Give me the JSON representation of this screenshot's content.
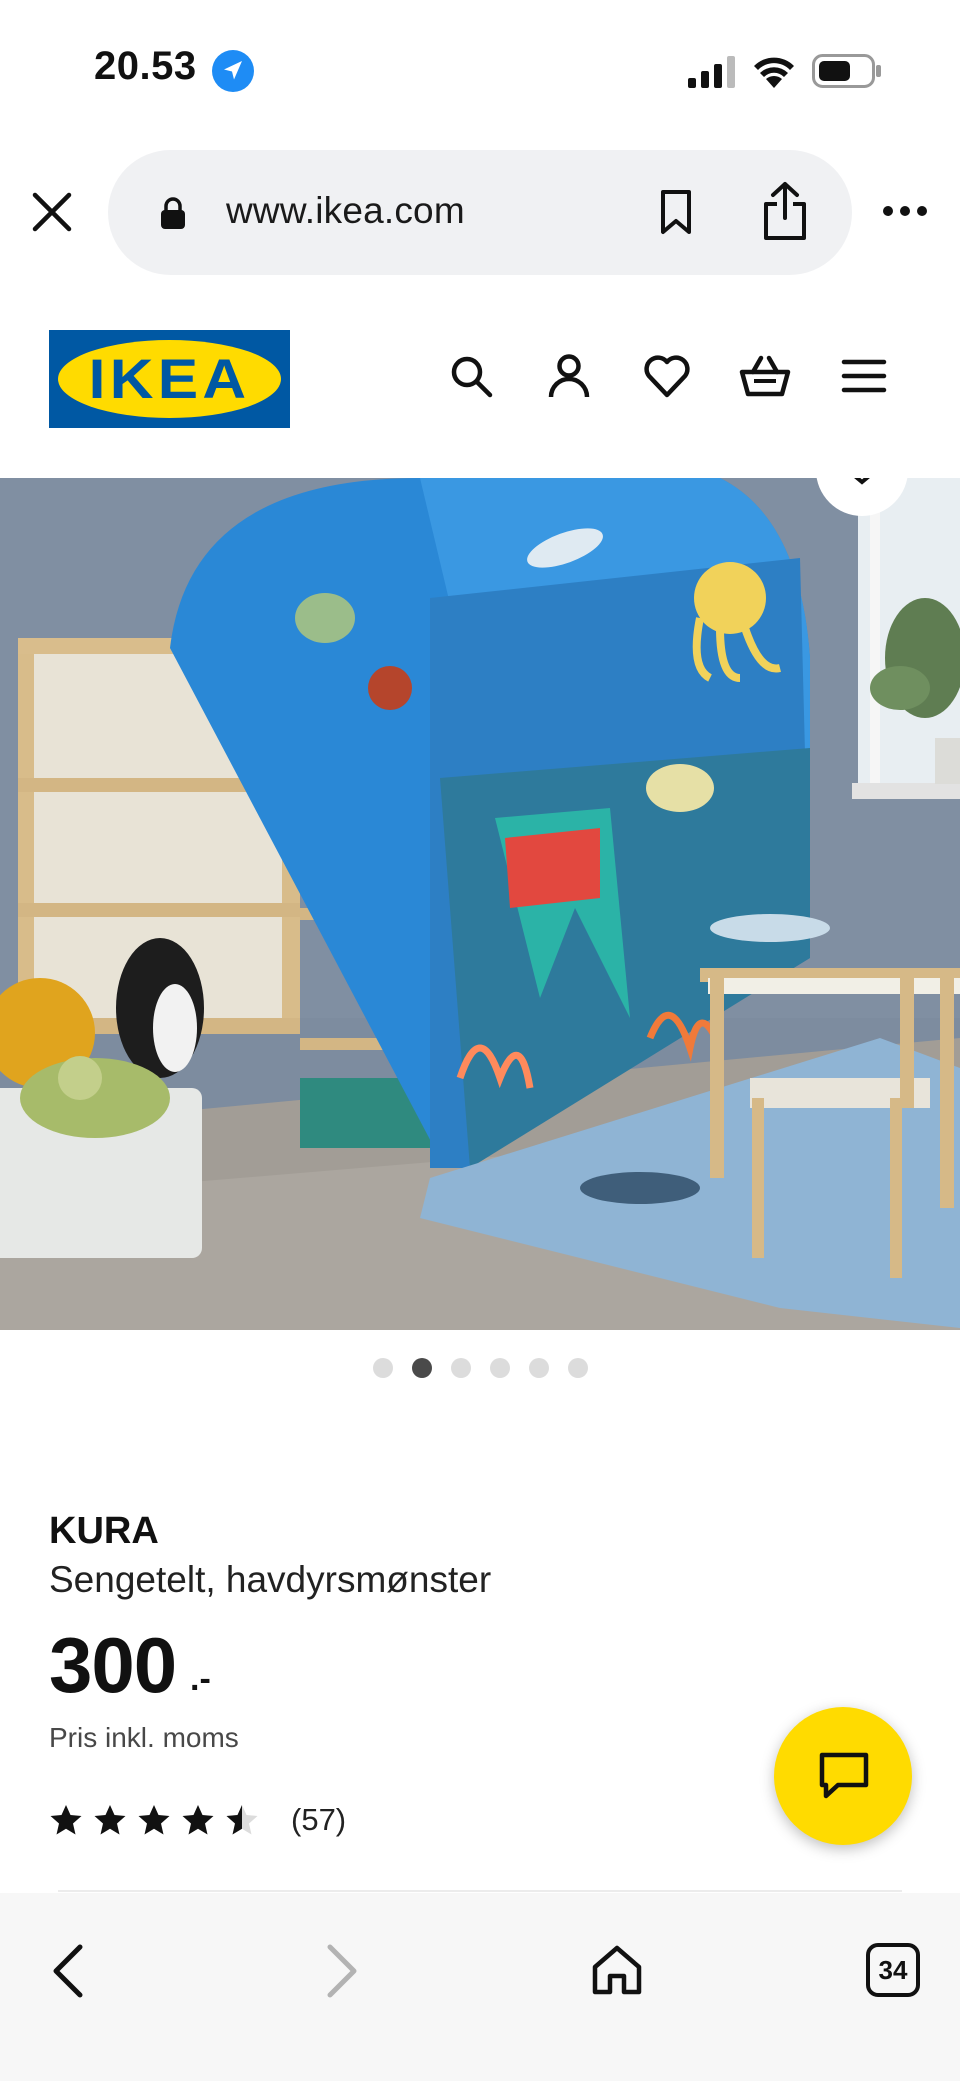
{
  "status_bar": {
    "time": "20.53",
    "icons": [
      "location-arrow-icon",
      "cellular-signal-icon",
      "wifi-icon",
      "battery-icon"
    ]
  },
  "browser": {
    "url": "www.ikea.com",
    "icons": [
      "close-icon",
      "lock-icon",
      "bookmark-icon",
      "share-icon",
      "more-icon"
    ]
  },
  "header": {
    "logo_text": "IKEA",
    "icons": [
      "search-icon",
      "account-icon",
      "heart-icon",
      "basket-icon",
      "hamburger-menu-icon"
    ]
  },
  "carousel": {
    "total": 6,
    "active_index": 1
  },
  "product": {
    "name": "KURA",
    "description": "Sengetelt, havdyrsmønster",
    "price": "300",
    "price_suffix": ".-",
    "price_note": "Pris inkl. moms",
    "rating": 4.5,
    "rating_max": 5,
    "review_count": "(57)"
  },
  "bottom_nav": {
    "tabs_count": "34",
    "icons": [
      "back-arrow-icon",
      "forward-arrow-icon",
      "home-icon",
      "tabs-icon"
    ]
  },
  "colors": {
    "ikea_blue": "#0058a3",
    "ikea_yellow": "#ffdb00",
    "location_blue": "#1e8cf5"
  }
}
